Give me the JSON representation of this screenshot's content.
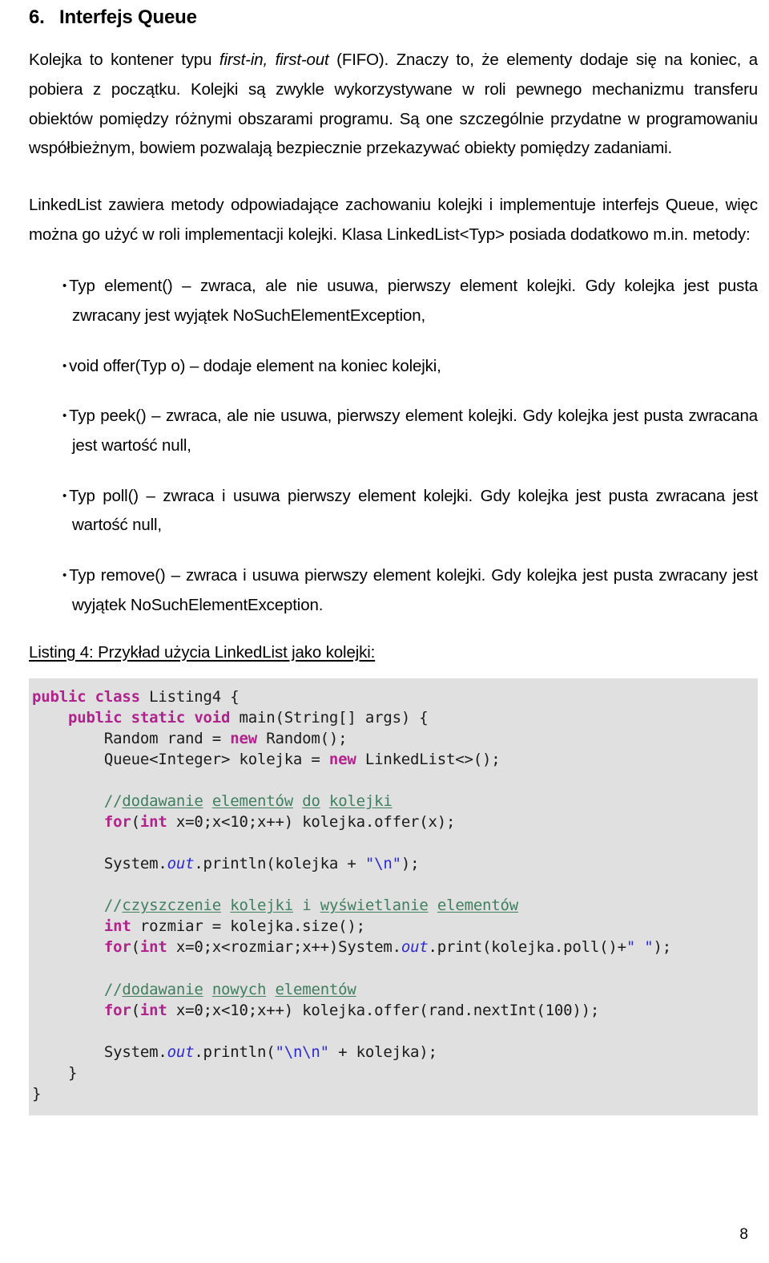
{
  "document": {
    "heading": {
      "number": "6.",
      "title": "Interfejs Queue"
    },
    "paragraphs": [
      {
        "id": "intro",
        "segments": [
          {
            "text": "Kolejka to kontener typu ",
            "style": "normal"
          },
          {
            "text": "first-in, first-out",
            "style": "italic"
          },
          {
            "text": " (FIFO). Znaczy to, że elementy dodaje się na koniec, a pobiera z początku. Kolejki są zwykle wykorzystywane w roli pewnego mechanizmu transferu obiektów pomiędzy różnymi obszarami programu. Są one szczególnie przydatne w programowaniu współbieżnym, bowiem pozwalają bezpiecznie przekazywać obiekty pomiędzy zadaniami.",
            "style": "normal"
          }
        ]
      },
      {
        "id": "linkedlist",
        "segments": [
          {
            "text": "LinkedList zawiera metody odpowiadające zachowaniu kolejki i implementuje interfejs Queue, więc można go użyć w roli implementacji kolejki. Klasa LinkedList<Typ> posiada dodatkowo m.in. metody:",
            "style": "normal"
          }
        ]
      }
    ],
    "bullets": [
      {
        "marker": "•",
        "text": "Typ element() – zwraca, ale nie usuwa, pierwszy element kolejki. Gdy kolejka jest pusta zwracany jest wyjątek NoSuchElementException,"
      },
      {
        "marker": "•",
        "text": "void offer(Typ o) – dodaje element na koniec kolejki,"
      },
      {
        "marker": "•",
        "text": "Typ peek() – zwraca, ale nie usuwa, pierwszy element kolejki. Gdy kolejka jest pusta zwracana jest wartość null,"
      },
      {
        "marker": "•",
        "text": "Typ poll() – zwraca i usuwa pierwszy element kolejki. Gdy kolejka jest pusta zwracana jest wartość null,"
      },
      {
        "marker": "•",
        "text": "Typ remove() – zwraca i usuwa pierwszy element kolejki. Gdy kolejka jest pusta zwracany jest wyjątek NoSuchElementException."
      }
    ],
    "listing_caption": "Listing 4: Przykład użycia LinkedList jako kolejki:",
    "code": {
      "language": "java",
      "lines": [
        [
          {
            "t": "public class",
            "c": "kw"
          },
          {
            "t": " Listing4 {",
            "c": "plain"
          }
        ],
        [
          {
            "t": "    ",
            "c": "plain"
          },
          {
            "t": "public static void",
            "c": "kw"
          },
          {
            "t": " main(String[] args) {",
            "c": "plain"
          }
        ],
        [
          {
            "t": "        Random rand = ",
            "c": "plain"
          },
          {
            "t": "new",
            "c": "kw"
          },
          {
            "t": " Random();",
            "c": "plain"
          }
        ],
        [
          {
            "t": "        Queue<Integer> kolejka = ",
            "c": "plain"
          },
          {
            "t": "new",
            "c": "kw"
          },
          {
            "t": " LinkedList<>();",
            "c": "plain"
          }
        ],
        [
          {
            "t": "",
            "c": "plain"
          }
        ],
        [
          {
            "t": "        ",
            "c": "plain"
          },
          {
            "t": "//dodawanie elementów do kolejki",
            "c": "cmt"
          }
        ],
        [
          {
            "t": "        ",
            "c": "plain"
          },
          {
            "t": "for",
            "c": "kw"
          },
          {
            "t": "(",
            "c": "plain"
          },
          {
            "t": "int",
            "c": "kw"
          },
          {
            "t": " x=0;x<10;x++) kolejka.offer(x);",
            "c": "plain"
          }
        ],
        [
          {
            "t": "",
            "c": "plain"
          }
        ],
        [
          {
            "t": "        System.",
            "c": "plain"
          },
          {
            "t": "out",
            "c": "fieldi"
          },
          {
            "t": ".println(kolejka + ",
            "c": "plain"
          },
          {
            "t": "\"\\n\"",
            "c": "str"
          },
          {
            "t": ");",
            "c": "plain"
          }
        ],
        [
          {
            "t": "",
            "c": "plain"
          }
        ],
        [
          {
            "t": "        ",
            "c": "plain"
          },
          {
            "t": "//czyszczenie kolejki i wyświetlanie elementów",
            "c": "cmt"
          }
        ],
        [
          {
            "t": "        ",
            "c": "plain"
          },
          {
            "t": "int",
            "c": "kw"
          },
          {
            "t": " rozmiar = kolejka.size();",
            "c": "plain"
          }
        ],
        [
          {
            "t": "        ",
            "c": "plain"
          },
          {
            "t": "for",
            "c": "kw"
          },
          {
            "t": "(",
            "c": "plain"
          },
          {
            "t": "int",
            "c": "kw"
          },
          {
            "t": " x=0;x<rozmiar;x++)System.",
            "c": "plain"
          },
          {
            "t": "out",
            "c": "fieldi"
          },
          {
            "t": ".print(kolejka.poll()+",
            "c": "plain"
          },
          {
            "t": "\" \"",
            "c": "str"
          },
          {
            "t": ");",
            "c": "plain"
          }
        ],
        [
          {
            "t": "",
            "c": "plain"
          }
        ],
        [
          {
            "t": "        ",
            "c": "plain"
          },
          {
            "t": "//dodawanie nowych elementów",
            "c": "cmt"
          }
        ],
        [
          {
            "t": "        ",
            "c": "plain"
          },
          {
            "t": "for",
            "c": "kw"
          },
          {
            "t": "(",
            "c": "plain"
          },
          {
            "t": "int",
            "c": "kw"
          },
          {
            "t": " x=0;x<10;x++) kolejka.offer(rand.nextInt(100));",
            "c": "plain"
          }
        ],
        [
          {
            "t": "",
            "c": "plain"
          }
        ],
        [
          {
            "t": "        System.",
            "c": "plain"
          },
          {
            "t": "out",
            "c": "fieldi"
          },
          {
            "t": ".println(",
            "c": "plain"
          },
          {
            "t": "\"\\n\\n\"",
            "c": "str"
          },
          {
            "t": " + kolejka);",
            "c": "plain"
          }
        ],
        [
          {
            "t": "    }",
            "c": "plain"
          }
        ],
        [
          {
            "t": "}",
            "c": "plain"
          }
        ]
      ],
      "colors": {
        "background": "#e0e0e0",
        "keyword": "#b0228c",
        "comment": "#3f7f5f",
        "string": "#2a2ad0",
        "field": "#2a2ad0",
        "plain": "#1a1a1a"
      }
    },
    "page_number": "8"
  }
}
